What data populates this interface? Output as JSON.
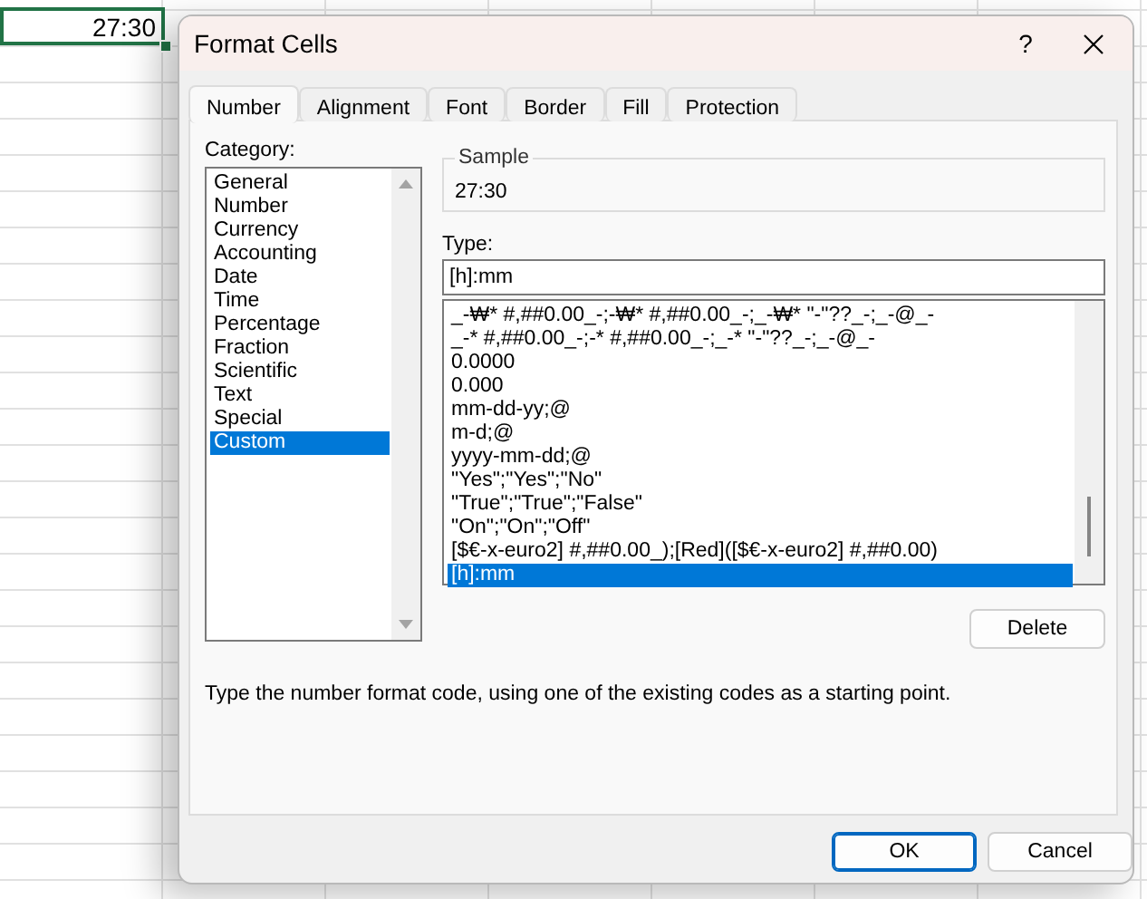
{
  "spreadsheet": {
    "active_cell": "27:30"
  },
  "window": {
    "title": "Format Cells",
    "help_button": "?"
  },
  "tabs": [
    {
      "label": "Number",
      "selected": true
    },
    {
      "label": "Alignment",
      "selected": false
    },
    {
      "label": "Font",
      "selected": false
    },
    {
      "label": "Border",
      "selected": false
    },
    {
      "label": "Fill",
      "selected": false
    },
    {
      "label": "Protection",
      "selected": false
    }
  ],
  "category": {
    "label": "Category:",
    "items": [
      {
        "label": "General",
        "selected": false
      },
      {
        "label": "Number",
        "selected": false
      },
      {
        "label": "Currency",
        "selected": false
      },
      {
        "label": "Accounting",
        "selected": false
      },
      {
        "label": "Date",
        "selected": false
      },
      {
        "label": "Time",
        "selected": false
      },
      {
        "label": "Percentage",
        "selected": false
      },
      {
        "label": "Fraction",
        "selected": false
      },
      {
        "label": "Scientific",
        "selected": false
      },
      {
        "label": "Text",
        "selected": false
      },
      {
        "label": "Special",
        "selected": false
      },
      {
        "label": "Custom",
        "selected": true
      }
    ]
  },
  "sample": {
    "label": "Sample",
    "value": "27:30"
  },
  "type": {
    "label": "Type:",
    "value": "[h]:mm",
    "formats": [
      {
        "label": "_-₩* #,##0.00_-;-₩* #,##0.00_-;_-₩* \"-\"??_-;_-@_-",
        "selected": false
      },
      {
        "label": "_-* #,##0.00_-;-* #,##0.00_-;_-* \"-\"??_-;_-@_-",
        "selected": false
      },
      {
        "label": "0.0000",
        "selected": false
      },
      {
        "label": "0.000",
        "selected": false
      },
      {
        "label": "mm-dd-yy;@",
        "selected": false
      },
      {
        "label": "m-d;@",
        "selected": false
      },
      {
        "label": "yyyy-mm-dd;@",
        "selected": false
      },
      {
        "label": "\"Yes\";\"Yes\";\"No\"",
        "selected": false
      },
      {
        "label": "\"True\";\"True\";\"False\"",
        "selected": false
      },
      {
        "label": "\"On\";\"On\";\"Off\"",
        "selected": false
      },
      {
        "label": "[$€-x-euro2] #,##0.00_);[Red]([$€-x-euro2] #,##0.00)",
        "selected": false
      },
      {
        "label": "[h]:mm",
        "selected": true
      }
    ]
  },
  "delete_button": "Delete",
  "description": "Type the number format code, using one of the existing codes as a starting point.",
  "buttons": [
    {
      "label": "OK",
      "kind": "default"
    },
    {
      "label": "Cancel",
      "kind": "normal"
    }
  ]
}
